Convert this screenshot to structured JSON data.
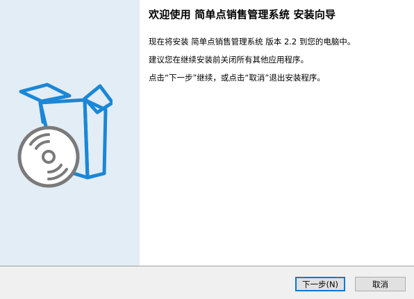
{
  "window": {
    "heading": "欢迎使用 简单点销售管理系统 安装向导",
    "paragraphs": [
      "现在将安装 简单点销售管理系统 版本 2.2 到您的电脑中。",
      "建议您在继续安装前关闭所有其他应用程序。",
      "点击“下一步”继续，或点击“取消”退出安装程序。"
    ]
  },
  "buttons": {
    "next": "下一步(N)",
    "cancel": "取消"
  },
  "icons": {
    "side_art": "box-with-disc-icon"
  },
  "colors": {
    "side_background": "#e3edf6",
    "box_blue": "#1b87d6",
    "disc_gray": "#7a7a7a",
    "footer": "#f0f0f0",
    "focus_border": "#0078d7"
  }
}
